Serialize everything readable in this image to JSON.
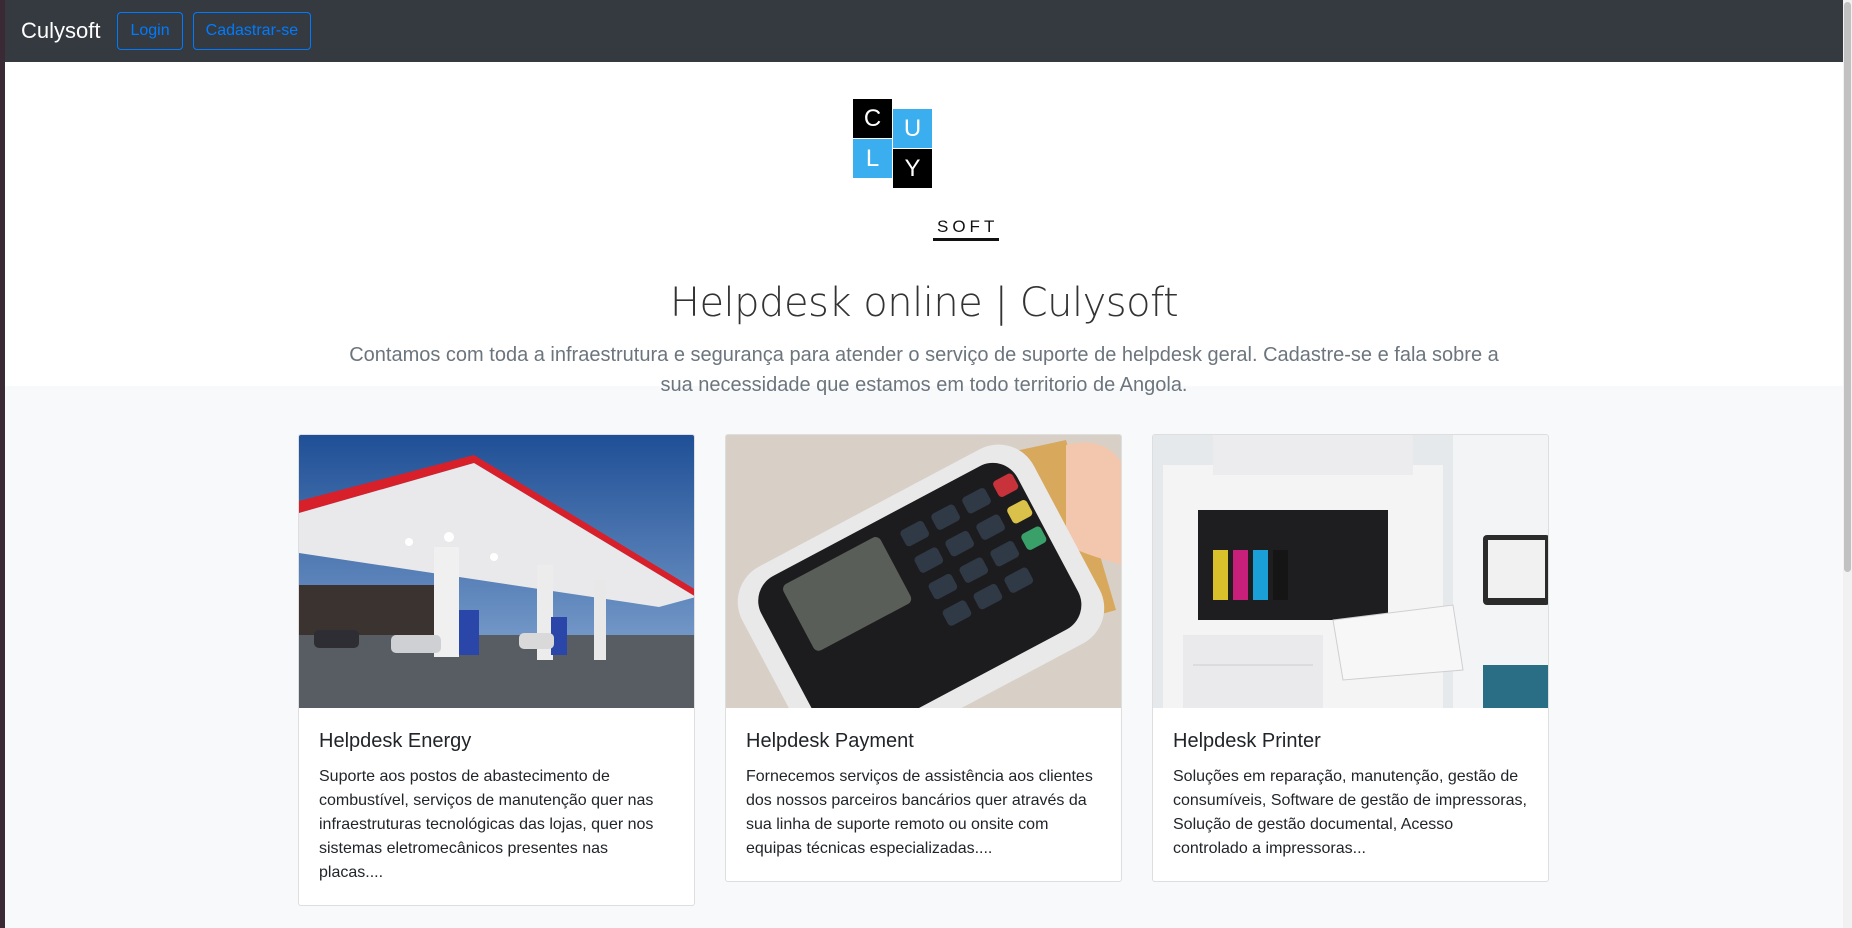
{
  "navbar": {
    "brand": "Culysoft",
    "login_label": "Login",
    "signup_label": "Cadastrar-se"
  },
  "logo": {
    "letters": [
      "C",
      "U",
      "L",
      "Y"
    ],
    "soft": "SOFT",
    "colors": {
      "black": "#000000",
      "blue": "#3aaeef"
    }
  },
  "hero": {
    "title": "Helpdesk online | Culysoft",
    "lead": "Contamos com toda a infraestrutura e segurança para atender o serviço de suporte de helpdesk geral. Cadastre-se e fala sobre a sua necessidade que estamos em todo territorio de Angola."
  },
  "cards": [
    {
      "title": "Helpdesk Energy",
      "text": "Suporte aos postos de abastecimento de combustível, serviços de manutenção quer nas infraestruturas tecnológicas das lojas, quer nos sistemas eletromecânicos presentes nas placas...."
    },
    {
      "title": "Helpdesk Payment",
      "text": "Fornecemos serviços de assistência aos clientes dos nossos parceiros bancários quer através da sua linha de suporte remoto ou onsite com equipas técnicas especializadas...."
    },
    {
      "title": "Helpdesk Printer",
      "text": "Soluções em reparação, manutenção, gestão de consumíveis, Software de gestão de impressoras, Solução de gestão documental, Acesso controlado a impressoras..."
    }
  ],
  "colors": {
    "navbar_bg": "#343a40",
    "primary": "#007bff",
    "muted": "#6c757d"
  }
}
